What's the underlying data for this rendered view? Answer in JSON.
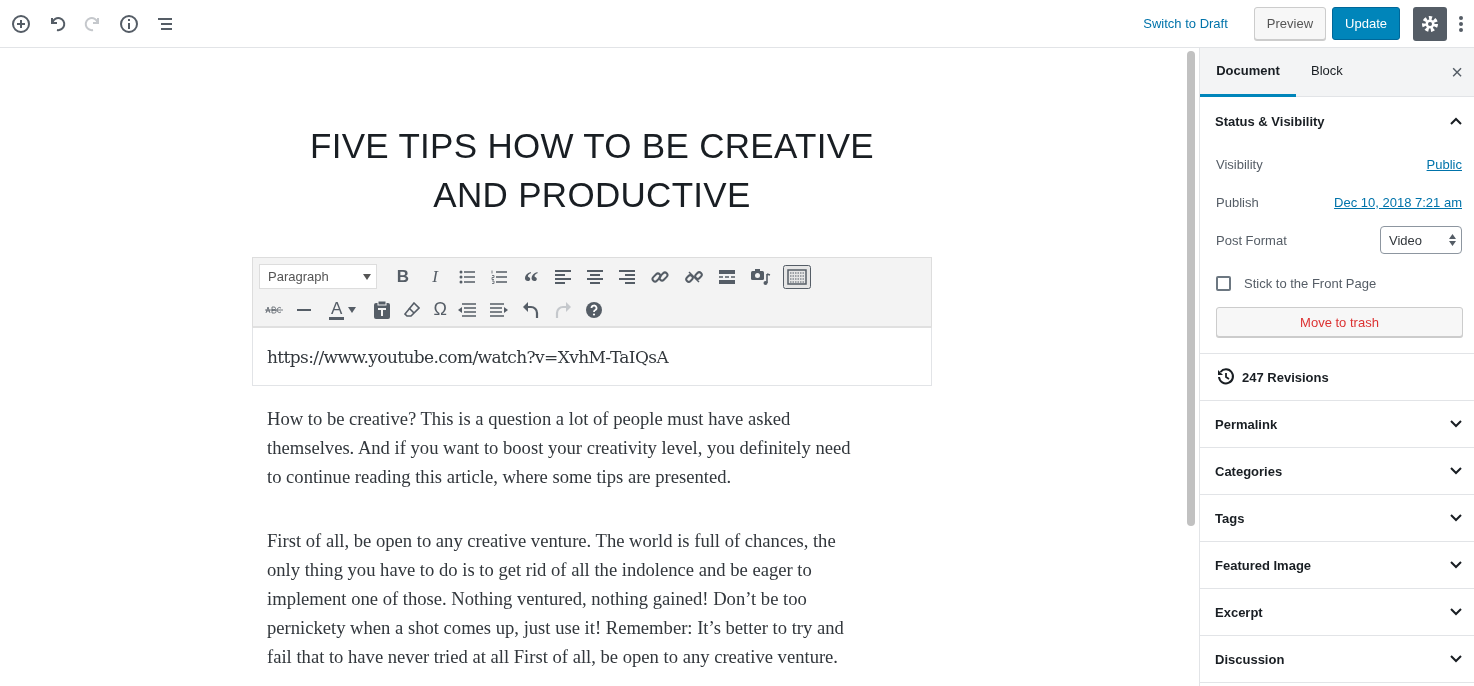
{
  "top_bar": {
    "switch_to_draft": "Switch to Draft",
    "preview": "Preview",
    "update": "Update",
    "settings_on": true
  },
  "title": "FIVE TIPS HOW TO BE CREATIVE AND PRODUCTIVE",
  "toolbar": {
    "format": "Paragraph",
    "bold": "B",
    "italic": "I",
    "quote": "“",
    "text_color": "A",
    "special_char": "Ω",
    "kitchen_sink_on": true
  },
  "embed_url": "https://www.youtube.com/watch?v=XvhM-TaIQsA",
  "paragraphs": [
    {
      "lines": [
        "How to be creative? This is a question a lot of people must have asked",
        "themselves. And if you want to boost your creativity level, you definitely need",
        "to continue reading this article, where some tips are presented."
      ]
    },
    {
      "lines": [
        "First of all, be open to any creative venture. The world is full of chances, the",
        "only thing you have to do is to get rid of all the indolence and be eager to",
        "implement one of those. Nothing ventured, nothing gained! Don’t be too",
        "pernickety when a shot comes up, just use it! Remember: It’s better to try and",
        "fail that to have never tried at all First of all, be open to any creative venture."
      ]
    }
  ],
  "sidebar": {
    "tabs": [
      {
        "label": "Document",
        "selected": true
      },
      {
        "label": "Block",
        "selected": false
      }
    ],
    "close": "×",
    "status": {
      "title": "Status & Visibility",
      "expanded": true,
      "visibility_label": "Visibility",
      "visibility": "Public",
      "publish_label": "Publish",
      "publish": "Dec 10, 2018 7:21 am",
      "format_label": "Post Format",
      "format": "Video",
      "sticky_label": "Stick to the Front Page",
      "sticky": false,
      "trash": "Move to trash"
    },
    "revisions": "247 Revisions",
    "panels": [
      {
        "title": "Permalink",
        "expanded": false
      },
      {
        "title": "Categories",
        "expanded": false
      },
      {
        "title": "Tags",
        "expanded": false
      },
      {
        "title": "Featured Image",
        "expanded": false
      },
      {
        "title": "Excerpt",
        "expanded": false
      },
      {
        "title": "Discussion",
        "expanded": false
      }
    ]
  }
}
